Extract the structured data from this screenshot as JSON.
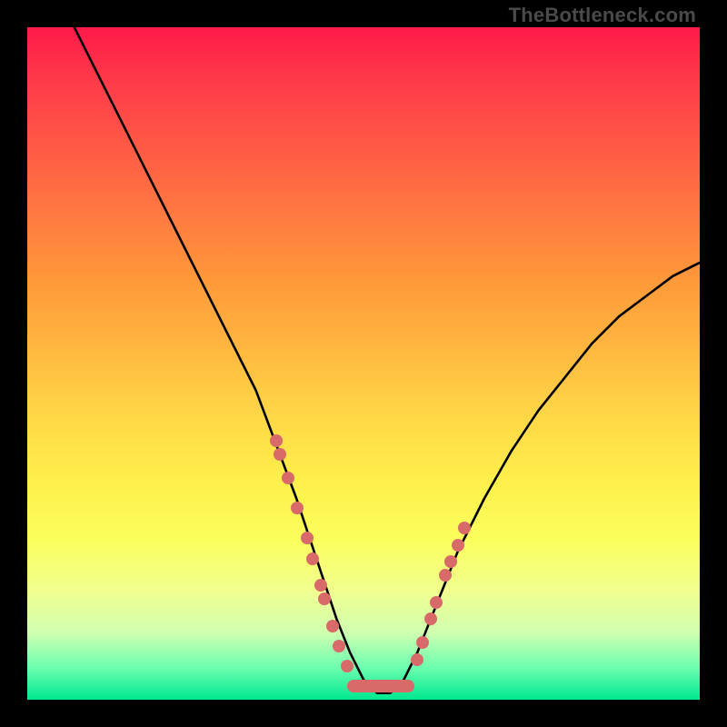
{
  "watermark": "TheBottleneck.com",
  "chart_data": {
    "type": "line",
    "title": "",
    "xlabel": "",
    "ylabel": "",
    "xlim": [
      0,
      100
    ],
    "ylim": [
      0,
      100
    ],
    "series": [
      {
        "name": "curve",
        "x": [
          7,
          10,
          14,
          18,
          22,
          26,
          30,
          34,
          37,
          40,
          42,
          44,
          46,
          48,
          50,
          52,
          54,
          56,
          58,
          60,
          64,
          68,
          72,
          76,
          80,
          84,
          88,
          92,
          96,
          100
        ],
        "y": [
          100,
          94,
          86,
          78,
          70,
          62,
          54,
          46,
          38,
          30,
          24,
          18,
          12,
          7,
          3,
          1,
          1,
          3,
          7,
          12,
          22,
          30,
          37,
          43,
          48,
          53,
          57,
          60,
          63,
          65
        ]
      }
    ],
    "markers_left": [
      {
        "x": 37.0,
        "y": 38.5
      },
      {
        "x": 37.6,
        "y": 36.5
      },
      {
        "x": 38.8,
        "y": 33.0
      },
      {
        "x": 40.2,
        "y": 28.5
      },
      {
        "x": 41.6,
        "y": 24.0
      },
      {
        "x": 42.4,
        "y": 21.0
      },
      {
        "x": 43.6,
        "y": 17.0
      },
      {
        "x": 44.2,
        "y": 15.0
      },
      {
        "x": 45.4,
        "y": 11.0
      },
      {
        "x": 46.4,
        "y": 8.0
      },
      {
        "x": 47.6,
        "y": 5.0
      }
    ],
    "markers_right": [
      {
        "x": 58.0,
        "y": 6.0
      },
      {
        "x": 58.8,
        "y": 8.5
      },
      {
        "x": 60.0,
        "y": 12.0
      },
      {
        "x": 60.8,
        "y": 14.5
      },
      {
        "x": 62.2,
        "y": 18.5
      },
      {
        "x": 63.0,
        "y": 20.5
      },
      {
        "x": 64.0,
        "y": 23.0
      },
      {
        "x": 65.0,
        "y": 25.5
      }
    ],
    "bottom_pill": {
      "x_from": 47.5,
      "x_to": 57.5,
      "y": 2
    }
  }
}
